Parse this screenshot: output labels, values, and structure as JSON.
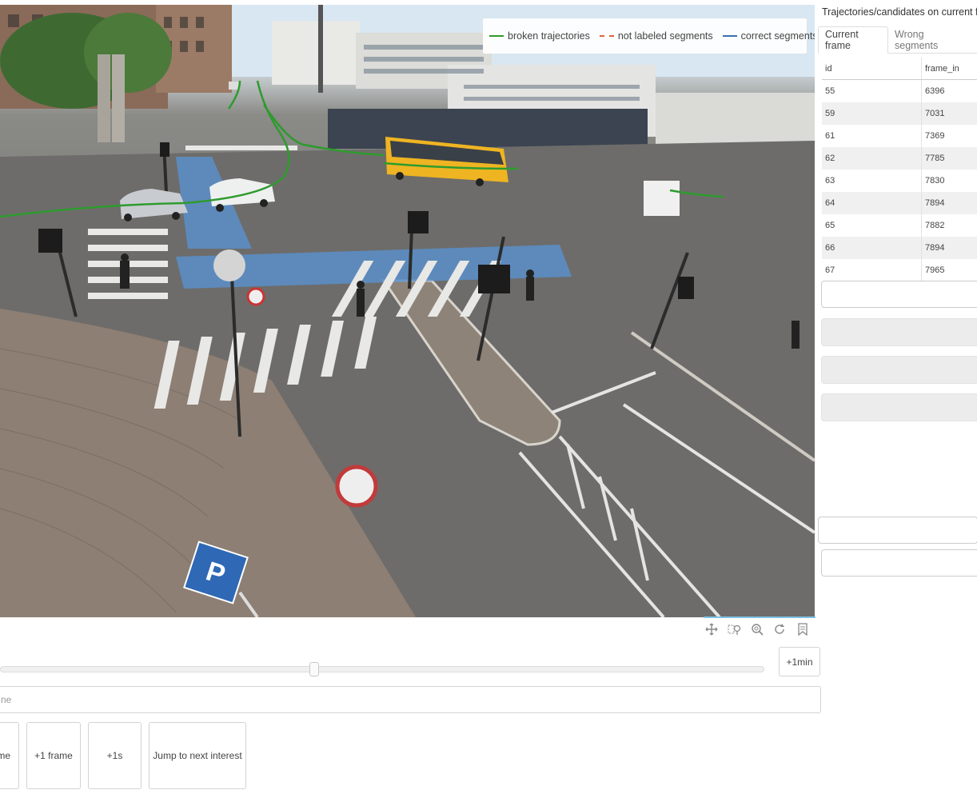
{
  "legend": {
    "items": [
      {
        "label": "broken trajectories",
        "color": "#2e9b2e",
        "style": "solid"
      },
      {
        "label": "not labeled segments",
        "color": "#e0643c",
        "style": "dashed"
      },
      {
        "label": "correct segments",
        "color": "#3a6fb0",
        "style": "solid"
      }
    ]
  },
  "toolbar": {
    "icons": [
      "pan-icon",
      "box-zoom-icon",
      "wheel-zoom-icon",
      "reset-icon",
      "save-icon"
    ]
  },
  "slider": {
    "position_fraction": 0.41
  },
  "buttons": {
    "plus_1min": "+1min",
    "frame_label": "me",
    "plus_1_frame": "+1 frame",
    "plus_1s": "+1s",
    "jump": "Jump to next interest"
  },
  "frame_input": {
    "value": "ne"
  },
  "panel": {
    "title": "Trajectories/candidates on current fran",
    "tabs": [
      "Current frame",
      "Wrong segments"
    ],
    "active_tab": 0,
    "table": {
      "columns": [
        "id",
        "frame_in"
      ],
      "rows": [
        [
          "55",
          "6396"
        ],
        [
          "59",
          "7031"
        ],
        [
          "61",
          "7369"
        ],
        [
          "62",
          "7785"
        ],
        [
          "63",
          "7830"
        ],
        [
          "64",
          "7894"
        ],
        [
          "65",
          "7882"
        ],
        [
          "66",
          "7894"
        ],
        [
          "67",
          "7965"
        ]
      ]
    }
  }
}
